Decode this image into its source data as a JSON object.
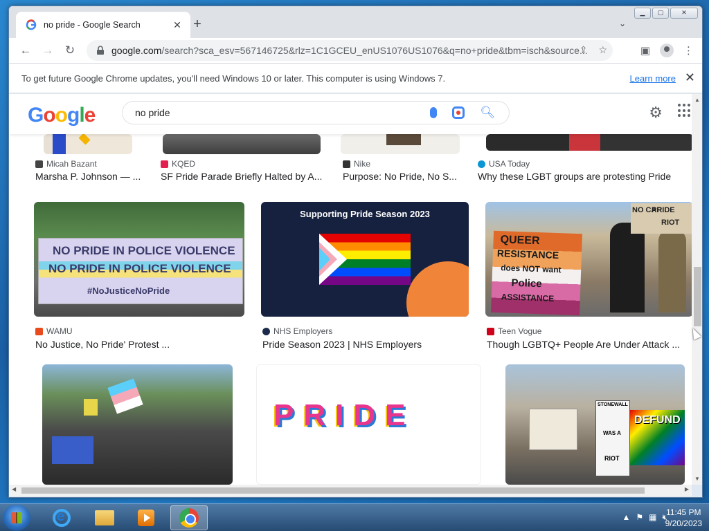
{
  "browser": {
    "tab_title": "no pride - Google Search",
    "url_host": "google.com",
    "url_path": "/search?sca_esv=567146725&rlz=1C1GCEU_enUS1076US1076&q=no+pride&tbm=isch&source...",
    "infobar_message": "To get future Google Chrome updates, you'll need Windows 10 or later. This computer is using Windows 7.",
    "learn_more": "Learn more"
  },
  "search": {
    "query": "no pride"
  },
  "logo": {
    "g1": "G",
    "o1": "o",
    "o2": "o",
    "g2": "g",
    "l": "l",
    "e": "e"
  },
  "results_row1": [
    {
      "source": "Micah Bazant",
      "caption": "Marsha P. Johnson — ...",
      "fav_color": "#444444"
    },
    {
      "source": "KQED",
      "caption": "SF Pride Parade Briefly Halted by A...",
      "fav_color": "#e21f4f"
    },
    {
      "source": "Nike",
      "caption": "Purpose: No Pride, No S...",
      "fav_color": "#333333"
    },
    {
      "source": "USA Today",
      "caption": "Why these LGBT groups are protesting Pride",
      "fav_color": "#0d96d4"
    }
  ],
  "results_row2": [
    {
      "source": "WAMU",
      "caption": "No Justice, No Pride' Protest ...",
      "fav_color": "#e8491d",
      "thumb_text": [
        "NO PRIDE IN POLICE VIOLENCE",
        "NO PRIDE IN POLICE VIOLENCE",
        "#NoJusticeNoPride"
      ]
    },
    {
      "source": "NHS Employers",
      "caption": "Pride Season 2023 | NHS Employers",
      "fav_color": "#1b2a4a",
      "thumb_text": [
        "Supporting Pride Season 2023"
      ]
    },
    {
      "source": "Teen Vogue",
      "caption": "Though LGBTQ+ People Are Under Attack ...",
      "fav_color": "#d0021b",
      "thumb_text": [
        "QUEER",
        "RESISTANCE",
        "does NOT want",
        "Police",
        "ASSISTANCE",
        "NO CAP",
        "PRIDE",
        "RIOT"
      ]
    }
  ],
  "results_row3": [
    {
      "thumb": "protest march"
    },
    {
      "thumb_text": "PRIDE"
    },
    {
      "thumb_text": [
        "STONEWALL",
        "WAS A",
        "RIOT",
        "DEFUND"
      ]
    }
  ],
  "taskbar": {
    "time": "11:45 PM",
    "date": "9/20/2023"
  }
}
